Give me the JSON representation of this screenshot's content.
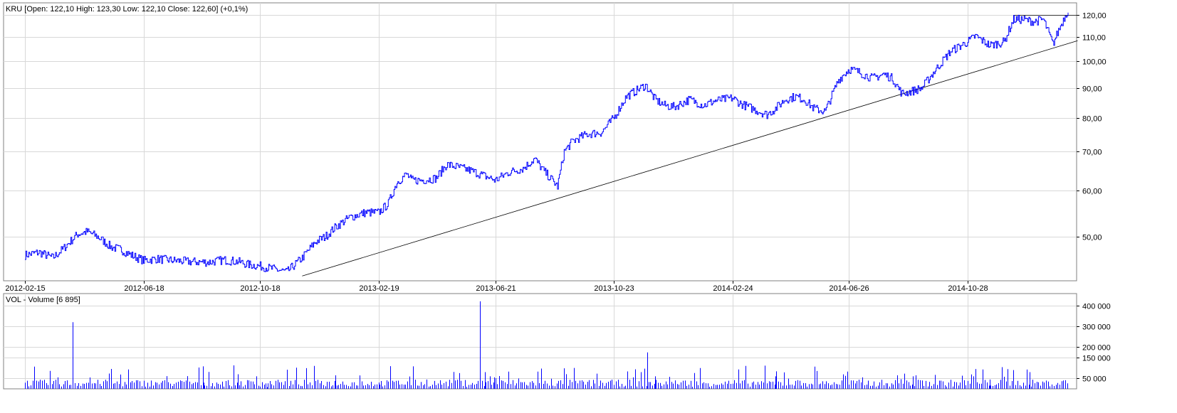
{
  "chart_data": [
    {
      "type": "line",
      "title": "KRU [Open: 122,10  High: 123,30  Low: 122,10  Close: 122,60] (+0,1%)",
      "x_tick_labels": [
        "2012-02-15",
        "2012-06-18",
        "2012-10-18",
        "2013-02-19",
        "2013-06-21",
        "2013-10-23",
        "2014-02-24",
        "2014-06-26",
        "2014-10-28"
      ],
      "y_scale": "log",
      "ylim": [
        42,
        126
      ],
      "y_ticks": [
        50,
        60,
        70,
        80,
        90,
        100,
        110,
        120
      ],
      "y_tick_labels": [
        "50,00",
        "60,00",
        "70,00",
        "80,00",
        "90,00",
        "100,00",
        "110,00",
        "120,00"
      ],
      "grid": true,
      "series_color": "#0000ff",
      "x_range": [
        "2012-02-15",
        "2015-02-10"
      ],
      "series": [
        {
          "x": [
            "2012-02-15",
            "2012-03-01",
            "2012-03-15",
            "2012-03-25",
            "2012-04-10",
            "2012-04-20",
            "2012-05-01",
            "2012-05-15",
            "2012-05-25",
            "2012-06-05",
            "2012-06-18",
            "2012-07-01",
            "2012-07-20",
            "2012-08-05",
            "2012-08-25",
            "2012-09-10",
            "2012-09-25",
            "2012-10-05",
            "2012-10-18",
            "2012-11-01",
            "2012-11-15",
            "2012-12-01",
            "2012-12-15",
            "2012-12-25",
            "2013-01-05",
            "2013-01-20",
            "2013-02-05",
            "2013-02-19",
            "2013-03-01",
            "2013-03-10",
            "2013-03-20",
            "2013-03-25",
            "2013-04-05",
            "2013-04-20",
            "2013-05-01",
            "2013-05-10",
            "2013-05-25",
            "2013-06-05",
            "2013-06-21",
            "2013-07-05",
            "2013-07-20",
            "2013-08-01",
            "2013-08-10",
            "2013-08-25",
            "2013-09-01",
            "2013-09-10",
            "2013-09-25",
            "2013-10-10",
            "2013-10-23",
            "2013-11-05",
            "2013-11-15",
            "2013-11-25",
            "2013-12-05",
            "2013-12-15",
            "2013-12-25",
            "2014-01-10",
            "2014-01-25",
            "2014-02-05",
            "2014-02-24",
            "2014-03-05",
            "2014-03-20",
            "2014-04-01",
            "2014-04-10",
            "2014-04-20",
            "2014-05-01",
            "2014-05-10",
            "2014-05-20",
            "2014-06-01",
            "2014-06-15",
            "2014-06-26",
            "2014-07-05",
            "2014-07-20",
            "2014-08-01",
            "2014-08-10",
            "2014-08-20",
            "2014-09-01",
            "2014-09-10",
            "2014-09-25",
            "2014-10-10",
            "2014-10-28",
            "2014-11-05",
            "2014-11-20",
            "2014-12-05",
            "2014-12-15",
            "2014-12-25",
            "2015-01-05",
            "2015-01-15",
            "2015-01-25",
            "2015-02-05",
            "2015-02-10"
          ],
          "y": [
            46.5,
            47.0,
            46.0,
            47.5,
            50.5,
            51.0,
            50.0,
            48.0,
            47.5,
            46.5,
            45.5,
            45.8,
            45.5,
            45.3,
            45.2,
            45.6,
            45.3,
            44.8,
            44.5,
            44.0,
            43.5,
            46.0,
            49.0,
            50.0,
            52.0,
            54.0,
            55.0,
            55.0,
            57.0,
            62.0,
            64.0,
            62.5,
            62.5,
            63.0,
            66.5,
            66.0,
            65.0,
            64.0,
            62.5,
            64.5,
            65.5,
            68.0,
            65.0,
            61.0,
            70.0,
            73.0,
            75.0,
            75.5,
            80.0,
            87.0,
            89.0,
            91.0,
            86.0,
            84.0,
            83.5,
            86.0,
            84.0,
            85.5,
            86.5,
            84.5,
            82.5,
            81.0,
            83.0,
            86.0,
            87.0,
            86.0,
            83.0,
            82.0,
            93.0,
            97.0,
            96.0,
            93.5,
            95.0,
            93.5,
            88.0,
            89.0,
            90.0,
            97.0,
            104.0,
            108.0,
            110.5,
            106.5,
            108.0,
            118.0,
            118.0,
            117.0,
            118.0,
            107.0,
            118.0,
            122.6
          ]
        }
      ],
      "trend_lines": [
        {
          "x": [
            "2012-12-01",
            "2015-02-20"
          ],
          "y": [
            42.8,
            108.5
          ]
        },
        {
          "x": [
            "2014-12-15",
            "2015-02-20"
          ],
          "y": [
            120.0,
            120.0
          ]
        }
      ]
    },
    {
      "type": "bar",
      "title": "VOL - Volume [6 895]",
      "ylim": [
        0,
        430000
      ],
      "y_ticks": [
        50000,
        150000,
        200000,
        300000,
        400000
      ],
      "y_tick_labels": [
        "50 000",
        "150 000",
        "200 000",
        "300 000",
        "400 000"
      ],
      "grid": true,
      "series_color": "#0000ff",
      "x": [
        "2012-02-15",
        "2012-03-20",
        "2012-04-05",
        "2012-05-25",
        "2012-08-20",
        "2012-09-25",
        "2012-10-25",
        "2013-01-05",
        "2013-02-20",
        "2013-03-01",
        "2013-04-10",
        "2013-05-10",
        "2013-06-05",
        "2013-06-10",
        "2013-06-15",
        "2013-06-20",
        "2013-07-15",
        "2013-11-12",
        "2013-11-20",
        "2013-11-27",
        "2013-12-05",
        "2014-04-10",
        "2014-07-10",
        "2014-08-15",
        "2014-09-01",
        "2014-09-10",
        "2014-11-03",
        "2014-11-20",
        "2014-12-15",
        "2015-01-01",
        "2015-01-10",
        "2015-02-05"
      ],
      "values": [
        15000,
        55000,
        320000,
        20000,
        30000,
        70000,
        8000,
        65000,
        20000,
        35000,
        45000,
        40000,
        420000,
        80000,
        60000,
        55000,
        50000,
        55000,
        80000,
        175000,
        60000,
        60000,
        55000,
        65000,
        60000,
        40000,
        60000,
        45000,
        90000,
        80000,
        25000,
        40000
      ]
    }
  ]
}
